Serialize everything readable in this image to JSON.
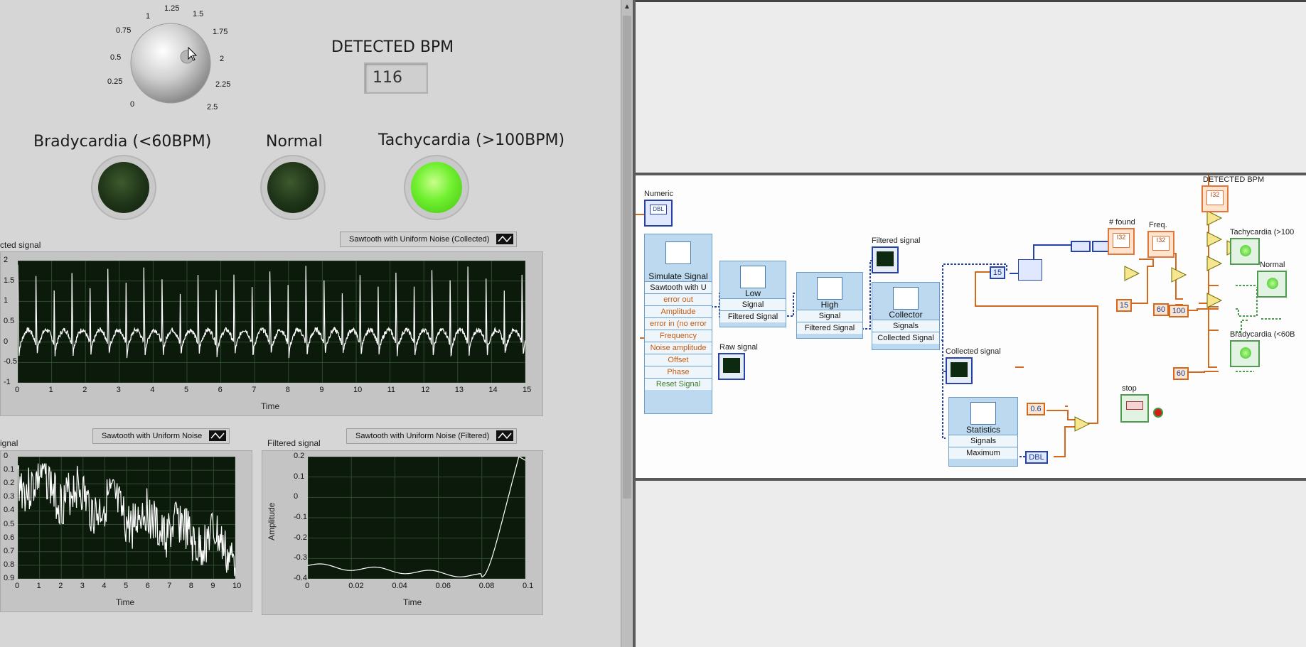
{
  "front_panel": {
    "knob": {
      "ticks": [
        "0",
        "0.25",
        "0.5",
        "0.75",
        "1",
        "1.25",
        "1.5",
        "1.75",
        "2",
        "2.25",
        "2.5"
      ]
    },
    "bpm_label": "DETECTED BPM",
    "bpm_value": "116",
    "indicators": [
      {
        "label": "Bradycardia (<60BPM)",
        "state": "off"
      },
      {
        "label": "Normal",
        "state": "off"
      },
      {
        "label": "Tachycardia (>100BPM)",
        "state": "on"
      }
    ],
    "collected_graph": {
      "title": "cted signal",
      "legend": "Sawtooth with Uniform Noise (Collected)",
      "xlabel": "Time",
      "x_ticks": [
        "0",
        "1",
        "2",
        "3",
        "4",
        "5",
        "6",
        "7",
        "8",
        "9",
        "10",
        "11",
        "12",
        "13",
        "14",
        "15"
      ],
      "y_ticks": [
        "2",
        "1.5",
        "1",
        "0.5",
        "0",
        "-0.5",
        "-1"
      ]
    },
    "raw_graph": {
      "title": "ignal",
      "legend": "Sawtooth with Uniform Noise",
      "xlabel": "Time",
      "x_ticks": [
        "0",
        "1",
        "2",
        "3",
        "4",
        "5",
        "6",
        "7",
        "8",
        "9",
        "10"
      ],
      "y_ticks": [
        "0",
        "0.1",
        "0.2",
        "0.3",
        "0.4",
        "0.5",
        "0.6",
        "0.7",
        "0.8",
        "0.9"
      ]
    },
    "filtered_graph": {
      "title": "Filtered signal",
      "legend": "Sawtooth with Uniform Noise (Filtered)",
      "xlabel": "Time",
      "ylabel": "Amplitude",
      "x_ticks": [
        "0",
        "0.02",
        "0.04",
        "0.06",
        "0.08",
        "0.1"
      ],
      "y_ticks": [
        "0.2",
        "0.1",
        "0",
        "-0.1",
        "-0.2",
        "-0.3",
        "-0.4"
      ]
    }
  },
  "block_diagram": {
    "numeric_label": "Numeric",
    "numeric_term": "DBL",
    "simulate_signal": {
      "title": "Simulate Signal",
      "rows": [
        "Sawtooth with U",
        "error out",
        "Amplitude",
        "error in (no error",
        "Frequency",
        "Noise amplitude",
        "Offset",
        "Phase",
        "Reset Signal"
      ]
    },
    "low_filter": {
      "title": "Low",
      "rows": [
        "Signal",
        "Filtered Signal"
      ]
    },
    "high_filter": {
      "title": "High",
      "rows": [
        "Signal",
        "Filtered Signal"
      ]
    },
    "collector": {
      "title": "Collector",
      "rows": [
        "Signals",
        "Collected Signal"
      ]
    },
    "statistics": {
      "title": "Statistics",
      "rows": [
        "Signals",
        "Maximum"
      ]
    },
    "labels": {
      "raw_signal": "Raw signal",
      "filtered_signal": "Filtered signal",
      "collected_signal": "Collected signal",
      "found": "# found",
      "freq": "Freq.",
      "detected_bpm": "DETECTED BPM",
      "tachycardia": "Tachycardia (>100",
      "normal": "Normal",
      "bradycardia": "Bradycardia (<60B",
      "stop": "stop"
    },
    "constants": {
      "c15a": "15",
      "c15b": "15",
      "c60a": "60",
      "c100": "100",
      "c60b": "60",
      "c06": "0.6"
    },
    "indicator_term": "I32",
    "dbl_term": "DBL"
  },
  "colors": {
    "panel": "#d6d6d6",
    "plot": "#0b1a0b",
    "led_on": "#6fef2e",
    "led_off": "#1e3317",
    "wire_orange": "#d2691e",
    "wire_blue": "#2843a8"
  }
}
